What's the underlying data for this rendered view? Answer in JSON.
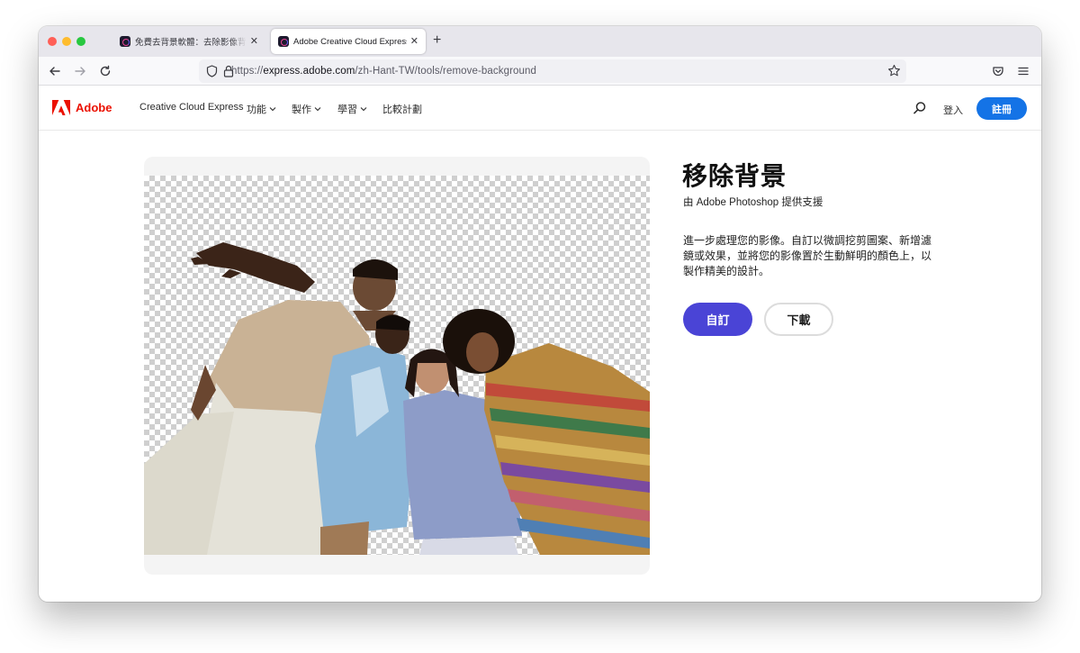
{
  "browser": {
    "tabs": [
      {
        "title": "免費去背景軟體：去除影像背景 | Ad",
        "active": false
      },
      {
        "title": "Adobe Creative Cloud Express",
        "active": true
      }
    ],
    "url_prefix": "https://",
    "url_host": "express.adobe.com",
    "url_path": "/zh-Hant-TW/tools/remove-background"
  },
  "header": {
    "logo_text": "Adobe",
    "nav": [
      "Creative Cloud Express",
      "功能",
      "製作",
      "學習",
      "比較計劃"
    ],
    "signin": "登入",
    "signup": "註冊"
  },
  "main": {
    "title": "移除背景",
    "powered_by": "由 Adobe Photoshop 提供支援",
    "description": "進一步處理您的影像。自訂以微調挖剪圖案、新增濾鏡或效果，並將您的影像置於生動鮮明的顏色上，以製作精美的設計。",
    "customize_label": "自訂",
    "download_label": "下載"
  },
  "colors": {
    "adobe_red": "#eb1000",
    "signup_blue": "#1473e6",
    "customize_purple": "#4a44d6"
  }
}
